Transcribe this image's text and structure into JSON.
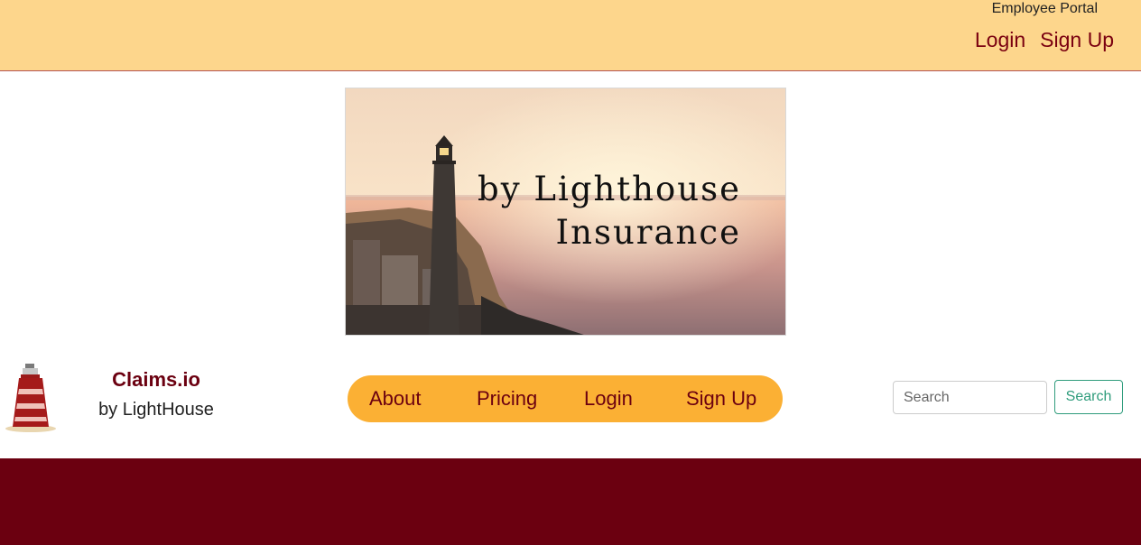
{
  "header": {
    "portal_label": "Employee Portal",
    "login_label": "Login",
    "signup_label": "Sign Up"
  },
  "hero": {
    "line1": "by Lighthouse",
    "line2": "Insurance"
  },
  "brand": {
    "name": "Claims.io",
    "tagline": "by LightHouse",
    "logo_icon": "lighthouse-icon"
  },
  "nav": {
    "items": [
      {
        "label": "About"
      },
      {
        "label": "Pricing"
      },
      {
        "label": "Login"
      },
      {
        "label": "Sign Up"
      }
    ]
  },
  "search": {
    "placeholder": "Search",
    "value": "",
    "button_label": "Search"
  },
  "colors": {
    "header_bg": "#fdd68c",
    "maroon": "#6b0010",
    "nav_pill": "#fbb034",
    "search_accent": "#2f9c7c"
  }
}
